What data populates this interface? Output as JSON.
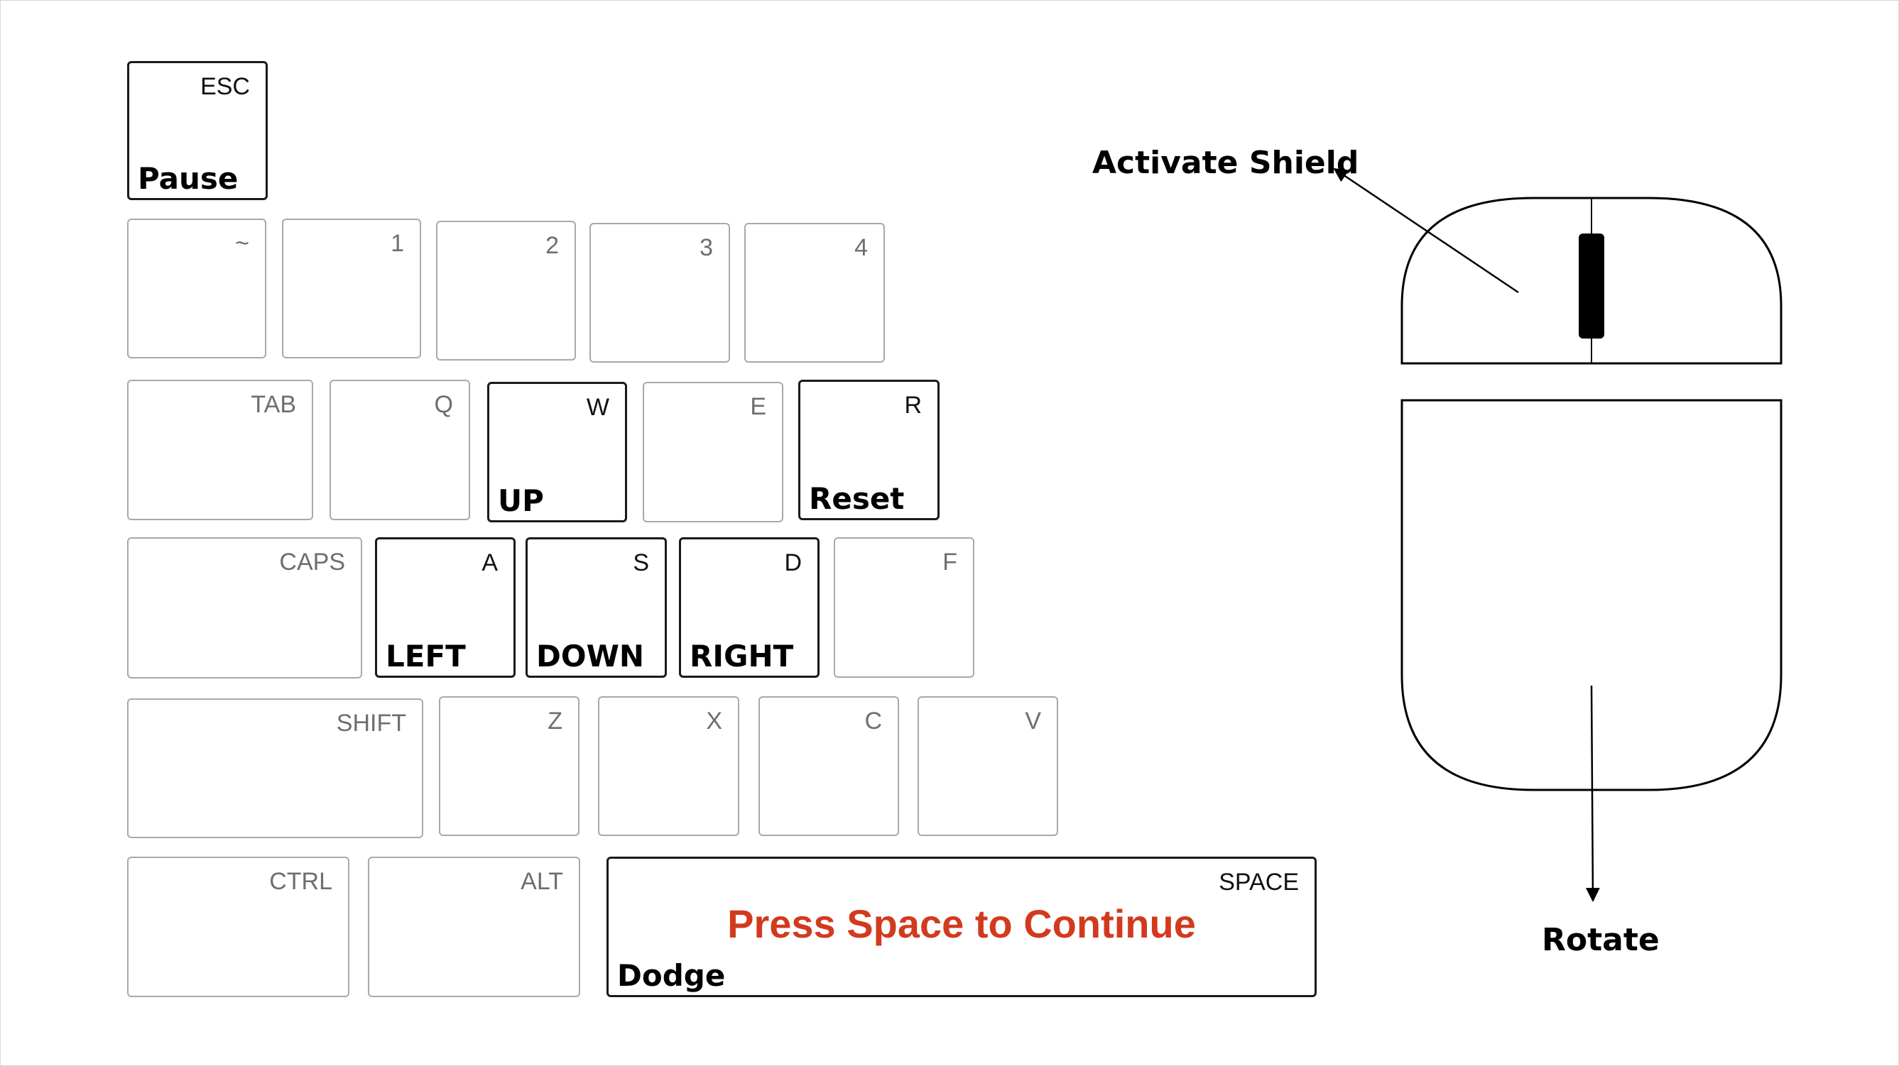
{
  "keyboard": {
    "esc": {
      "key": "ESC",
      "action": "Pause"
    },
    "number_row": [
      "~",
      "1",
      "2",
      "3",
      "4"
    ],
    "tab_row": {
      "tab": "TAB",
      "q": "Q",
      "w": {
        "key": "W",
        "action": "UP"
      },
      "e": "E",
      "r": {
        "key": "R",
        "action": "Reset"
      }
    },
    "caps_row": {
      "caps": "CAPS",
      "a": {
        "key": "A",
        "action": "LEFT"
      },
      "s": {
        "key": "S",
        "action": "DOWN"
      },
      "d": {
        "key": "D",
        "action": "RIGHT"
      },
      "f": "F"
    },
    "shift_row": [
      "SHIFT",
      "Z",
      "X",
      "C",
      "V"
    ],
    "bottom_row": {
      "ctrl": "CTRL",
      "alt": "ALT",
      "space": {
        "key": "SPACE",
        "action": "Dodge"
      }
    }
  },
  "prompt": {
    "text": "Press Space to Continue",
    "color": "#d23a1e"
  },
  "mouse": {
    "scroll_label": "Activate Shield",
    "move_label": "Rotate"
  },
  "colors": {
    "active_border": "#1a1a1a",
    "inactive_border": "#a9a9a9",
    "inactive_text": "#6e6e6e"
  }
}
